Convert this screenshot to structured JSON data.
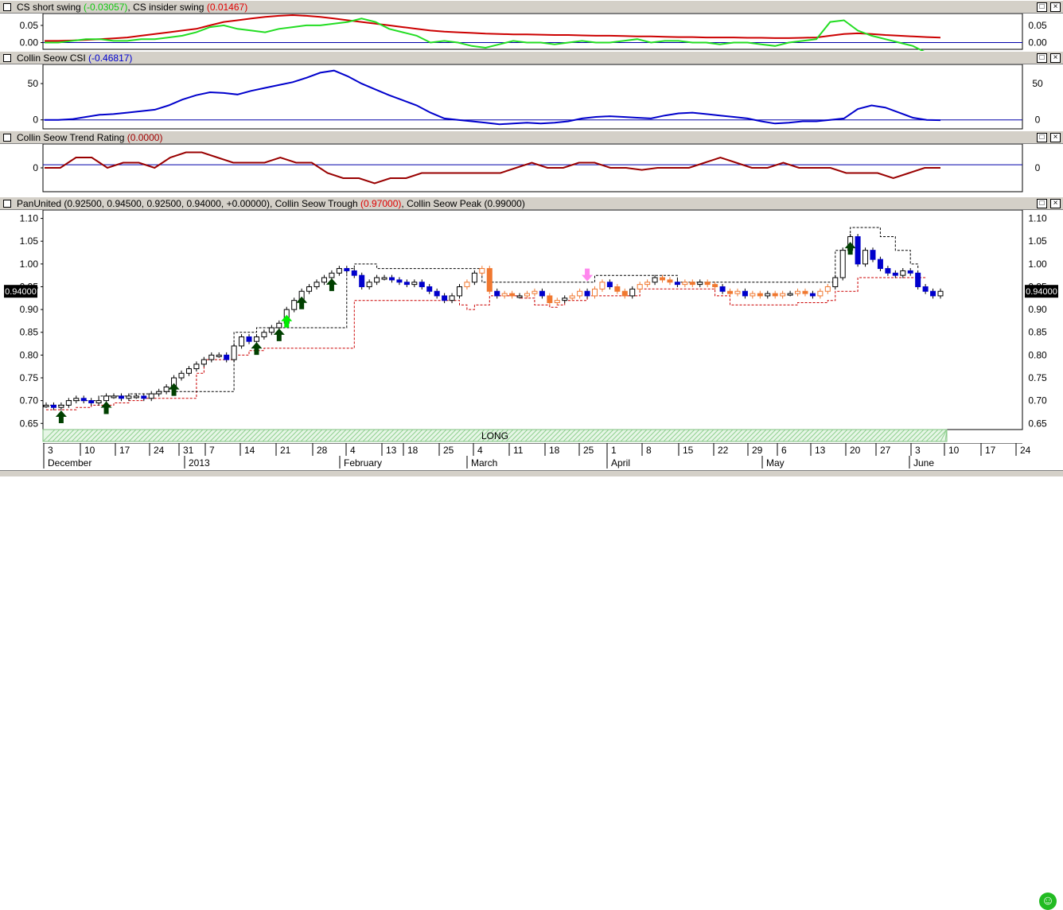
{
  "panes": {
    "swing": {
      "name": "CS short swing",
      "short_value": "(-0.03057)",
      "separator": ",",
      "insider_name": "CS insider swing",
      "insider_value": "(0.01467)",
      "ticks": [
        "0.05",
        "0.00"
      ]
    },
    "csi": {
      "name": "Collin Seow CSI",
      "value": "(-0.46817)",
      "ticks": [
        "50",
        "0"
      ]
    },
    "trend": {
      "name": "Collin Seow Trend Rating",
      "value": "(0.0000)",
      "ticks": [
        "0"
      ]
    },
    "price": {
      "name": "PanUnited",
      "ohlc": "(0.92500, 0.94500, 0.92500, 0.94000, +0.00000)",
      "trough_name": ", Collin Seow Trough",
      "trough_value": "(0.97000)",
      "peak_name": ", Collin Seow Peak",
      "peak_value": "(0.99000)",
      "last_price": "0.94000",
      "ticks": [
        "1.10",
        "1.05",
        "1.00",
        "0.95",
        "0.90",
        "0.85",
        "0.80",
        "0.75",
        "0.70",
        "0.65"
      ],
      "band_label": "LONG"
    }
  },
  "buttons": {
    "maximize": "□",
    "close": "×"
  },
  "time_axis": {
    "day_labels": [
      "3",
      "10",
      "17",
      "24",
      "31",
      "7",
      "14",
      "21",
      "28",
      "4",
      "13",
      "18",
      "25",
      "4",
      "11",
      "18",
      "25",
      "1",
      "8",
      "15",
      "22",
      "29",
      "6",
      "13",
      "20",
      "27",
      "3",
      "10",
      "17",
      "24"
    ],
    "month_labels": [
      "December",
      "2013",
      "February",
      "March",
      "April",
      "May",
      "June"
    ]
  },
  "colors": {
    "short_swing": "#22dd22",
    "insider_swing": "#cc0000",
    "csi": "#0000cc",
    "trend": "#990000",
    "bull_candle": "#0000cc",
    "bear_candle_orange": "#f07830",
    "arrow_dark": "#004000",
    "arrow_bright": "#00ee00",
    "arrow_pink": "#ff88ee"
  },
  "chart_data": [
    {
      "type": "line",
      "series": [
        {
          "name": "CS short swing",
          "values": [
            0.0,
            0.0,
            0.005,
            0.01,
            0.01,
            0.005,
            0.005,
            0.01,
            0.01,
            0.015,
            0.02,
            0.03,
            0.045,
            0.05,
            0.04,
            0.035,
            0.03,
            0.04,
            0.045,
            0.05,
            0.05,
            0.055,
            0.06,
            0.07,
            0.06,
            0.04,
            0.03,
            0.02,
            0.0,
            0.005,
            0.0,
            -0.01,
            -0.015,
            -0.005,
            0.005,
            0.0,
            0.0,
            -0.005,
            0.0,
            0.005,
            0.0,
            0.0,
            0.005,
            0.01,
            0.0,
            0.005,
            0.005,
            0.0,
            0.0,
            -0.005,
            0.0,
            0.0,
            -0.005,
            -0.01,
            0.0,
            0.005,
            0.01,
            0.06,
            0.065,
            0.035,
            0.02,
            0.01,
            0.0,
            -0.01,
            -0.03,
            -0.03
          ]
        },
        {
          "name": "CS insider swing",
          "values": [
            0.005,
            0.005,
            0.006,
            0.008,
            0.01,
            0.012,
            0.015,
            0.02,
            0.025,
            0.03,
            0.035,
            0.04,
            0.05,
            0.06,
            0.065,
            0.07,
            0.075,
            0.078,
            0.08,
            0.078,
            0.075,
            0.07,
            0.065,
            0.06,
            0.055,
            0.05,
            0.045,
            0.04,
            0.035,
            0.032,
            0.03,
            0.028,
            0.026,
            0.025,
            0.024,
            0.024,
            0.023,
            0.022,
            0.022,
            0.021,
            0.02,
            0.02,
            0.019,
            0.018,
            0.018,
            0.017,
            0.016,
            0.016,
            0.015,
            0.015,
            0.015,
            0.014,
            0.014,
            0.013,
            0.013,
            0.014,
            0.015,
            0.02,
            0.025,
            0.027,
            0.025,
            0.022,
            0.02,
            0.018,
            0.016,
            0.0147
          ]
        }
      ],
      "ylim": [
        -0.015,
        0.08
      ]
    },
    {
      "type": "line",
      "series": [
        {
          "name": "Collin Seow CSI",
          "values": [
            0,
            0,
            1,
            4,
            7,
            8,
            10,
            12,
            14,
            20,
            28,
            34,
            38,
            37,
            35,
            40,
            44,
            48,
            52,
            58,
            65,
            68,
            60,
            50,
            42,
            34,
            27,
            20,
            10,
            2,
            0,
            -2,
            -4,
            -6,
            -5,
            -4,
            -5,
            -4,
            -2,
            2,
            4,
            5,
            4,
            3,
            2,
            6,
            9,
            10,
            8,
            6,
            4,
            2,
            -2,
            -5,
            -4,
            -2,
            -2,
            0,
            2,
            15,
            20,
            17,
            10,
            3,
            0,
            -0.47
          ]
        }
      ],
      "ylim": [
        -8,
        72
      ]
    },
    {
      "type": "line",
      "series": [
        {
          "name": "Collin Seow Trend Rating",
          "values": [
            0,
            0,
            1,
            1,
            0,
            0.5,
            0.5,
            0,
            1,
            1.5,
            1.5,
            1,
            0.5,
            0.5,
            0.5,
            1,
            0.5,
            0.5,
            -0.5,
            -1,
            -1,
            -1.5,
            -1,
            -1,
            -0.5,
            -0.5,
            -0.5,
            -0.5,
            -0.5,
            -0.5,
            0,
            0.5,
            0,
            0,
            0.5,
            0.5,
            0,
            0,
            -0.2,
            0,
            0,
            0,
            0.5,
            1,
            0.5,
            0,
            0,
            0.5,
            0,
            0,
            0,
            -0.5,
            -0.5,
            -0.5,
            -1,
            -0.5,
            0,
            0
          ]
        }
      ],
      "ylim": [
        -2,
        2
      ]
    },
    {
      "type": "candlestick",
      "x_range": [
        "2012-12-03",
        "2013-06-07"
      ],
      "ylim": [
        0.64,
        1.115
      ],
      "close": [
        0.69,
        0.685,
        0.69,
        0.7,
        0.705,
        0.7,
        0.695,
        0.7,
        0.71,
        0.71,
        0.705,
        0.71,
        0.71,
        0.705,
        0.715,
        0.72,
        0.73,
        0.75,
        0.76,
        0.77,
        0.78,
        0.79,
        0.8,
        0.8,
        0.79,
        0.82,
        0.84,
        0.83,
        0.84,
        0.85,
        0.86,
        0.87,
        0.9,
        0.92,
        0.94,
        0.95,
        0.96,
        0.97,
        0.98,
        0.99,
        0.985,
        0.975,
        0.95,
        0.96,
        0.97,
        0.97,
        0.965,
        0.96,
        0.955,
        0.96,
        0.95,
        0.94,
        0.93,
        0.92,
        0.93,
        0.95,
        0.96,
        0.98,
        0.99,
        0.94,
        0.93,
        0.935,
        0.93,
        0.93,
        0.935,
        0.94,
        0.93,
        0.915,
        0.92,
        0.925,
        0.93,
        0.94,
        0.93,
        0.945,
        0.96,
        0.95,
        0.94,
        0.93,
        0.945,
        0.955,
        0.96,
        0.97,
        0.965,
        0.96,
        0.955,
        0.96,
        0.955,
        0.96,
        0.955,
        0.95,
        0.94,
        0.935,
        0.94,
        0.93,
        0.935,
        0.93,
        0.935,
        0.93,
        0.935,
        0.935,
        0.94,
        0.935,
        0.93,
        0.94,
        0.95,
        0.97,
        1.03,
        1.06,
        1.0,
        1.03,
        1.01,
        0.99,
        0.98,
        0.975,
        0.985,
        0.98,
        0.95,
        0.94,
        0.93,
        0.94
      ],
      "peak": [
        0.69,
        0.69,
        0.69,
        0.7,
        0.7,
        0.7,
        0.7,
        0.71,
        0.71,
        0.71,
        0.71,
        0.715,
        0.715,
        0.715,
        0.715,
        0.72,
        0.72,
        0.72,
        0.72,
        0.72,
        0.72,
        0.72,
        0.72,
        0.72,
        0.72,
        0.85,
        0.85,
        0.85,
        0.86,
        0.86,
        0.86,
        0.86,
        0.86,
        0.86,
        0.86,
        0.86,
        0.86,
        0.86,
        0.86,
        0.86,
        0.99,
        1.0,
        1.0,
        1.0,
        0.99,
        0.99,
        0.99,
        0.99,
        0.99,
        0.99,
        0.99,
        0.99,
        0.99,
        0.99,
        0.99,
        0.99,
        0.99,
        0.99,
        0.96,
        0.96,
        0.96,
        0.96,
        0.96,
        0.96,
        0.96,
        0.96,
        0.96,
        0.96,
        0.96,
        0.96,
        0.96,
        0.96,
        0.96,
        0.975,
        0.975,
        0.975,
        0.975,
        0.975,
        0.975,
        0.975,
        0.975,
        0.975,
        0.975,
        0.975,
        0.96,
        0.96,
        0.96,
        0.96,
        0.96,
        0.96,
        0.96,
        0.96,
        0.96,
        0.96,
        0.96,
        0.96,
        0.96,
        0.96,
        0.96,
        0.96,
        0.96,
        0.96,
        0.96,
        0.96,
        0.96,
        1.03,
        1.03,
        1.08,
        1.08,
        1.08,
        1.08,
        1.06,
        1.06,
        1.03,
        1.03,
        1.0,
        0.99
      ],
      "trough": [
        0.68,
        0.68,
        0.68,
        0.68,
        0.685,
        0.685,
        0.69,
        0.69,
        0.69,
        0.695,
        0.695,
        0.7,
        0.7,
        0.705,
        0.705,
        0.705,
        0.705,
        0.705,
        0.705,
        0.705,
        0.76,
        0.79,
        0.79,
        0.79,
        0.79,
        0.8,
        0.8,
        0.81,
        0.81,
        0.815,
        0.815,
        0.815,
        0.815,
        0.815,
        0.815,
        0.815,
        0.815,
        0.815,
        0.815,
        0.815,
        0.815,
        0.92,
        0.92,
        0.92,
        0.92,
        0.92,
        0.92,
        0.92,
        0.92,
        0.92,
        0.92,
        0.92,
        0.92,
        0.92,
        0.92,
        0.91,
        0.9,
        0.91,
        0.91,
        0.93,
        0.93,
        0.93,
        0.93,
        0.925,
        0.925,
        0.91,
        0.91,
        0.905,
        0.91,
        0.92,
        0.92,
        0.92,
        0.93,
        0.93,
        0.93,
        0.93,
        0.93,
        0.93,
        0.93,
        0.945,
        0.945,
        0.945,
        0.945,
        0.945,
        0.945,
        0.945,
        0.945,
        0.945,
        0.945,
        0.93,
        0.93,
        0.91,
        0.91,
        0.91,
        0.91,
        0.91,
        0.91,
        0.91,
        0.91,
        0.91,
        0.915,
        0.915,
        0.915,
        0.915,
        0.92,
        0.94,
        0.94,
        0.94,
        0.97,
        0.97,
        0.97,
        0.97,
        0.97,
        0.97,
        0.97,
        0.97,
        0.97,
        0.97
      ]
    }
  ]
}
